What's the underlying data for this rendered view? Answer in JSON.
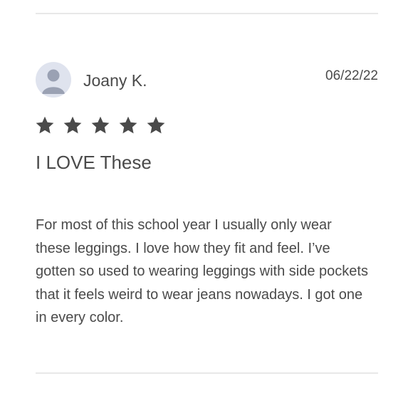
{
  "review": {
    "reviewer_name": "Joany K.",
    "date": "06/22/22",
    "rating": 5,
    "rating_max": 5,
    "title": "I LOVE These",
    "body": "For most of this school year I usually only wear these leggings. I love how they fit and feel. I’ve gotten so used to wearing leggings with side pockets that it feels weird to wear jeans nowadays. I got one in every color.",
    "avatar_icon": "user-silhouette-icon",
    "star_icon": "star-icon"
  },
  "colors": {
    "text": "#4a4a4a",
    "star": "#4a4a4a",
    "divider": "#e8e8e8",
    "avatar_bg": "#dfe3ee",
    "avatar_figure": "#9aa1b3"
  }
}
